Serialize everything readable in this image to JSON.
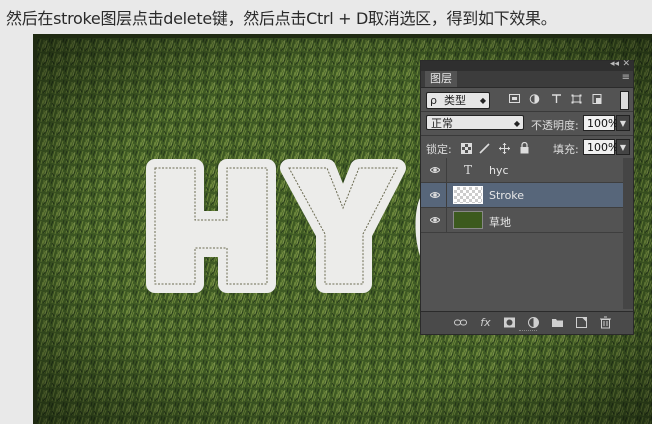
{
  "instruction": "然后在stroke图层点击delete键，然后点击Ctrl + D取消选区，得到如下效果。",
  "canvas": {
    "artwork_text": "HYC"
  },
  "layers_panel": {
    "collapse_glyph": "◂◂",
    "close_glyph": "✕",
    "tab_label": "图层",
    "menu_glyph": "≡",
    "filter": {
      "search_glyph": "ρ",
      "kind_label": "类型",
      "arrow": "◆"
    },
    "filter_icons": [
      "image-filter-icon",
      "adjustment-filter-icon",
      "type-filter-icon",
      "shape-filter-icon",
      "smart-object-filter-icon"
    ],
    "blend_mode": "正常",
    "opacity_label": "不透明度:",
    "opacity_value": "100%",
    "lock_label": "锁定:",
    "fill_label": "填充:",
    "fill_value": "100%",
    "layers": [
      {
        "name": "hyc",
        "type": "text",
        "thumb_glyph": "T",
        "visible": true,
        "selected": false
      },
      {
        "name": "Stroke",
        "type": "pixel-transparent",
        "visible": true,
        "selected": true
      },
      {
        "name": "草地",
        "type": "pixel-grass",
        "visible": true,
        "selected": false
      }
    ],
    "bottom_icons": [
      "link-layers-icon",
      "fx-icon",
      "add-mask-icon",
      "adjustment-layer-icon",
      "new-group-icon",
      "new-layer-icon",
      "delete-layer-icon"
    ],
    "fx_glyph": "fx"
  },
  "colors": {
    "panel_bg": "#535353",
    "selected_layer": "#57667a",
    "grass": "#3f5a24",
    "letter_fill": "#ececea"
  }
}
